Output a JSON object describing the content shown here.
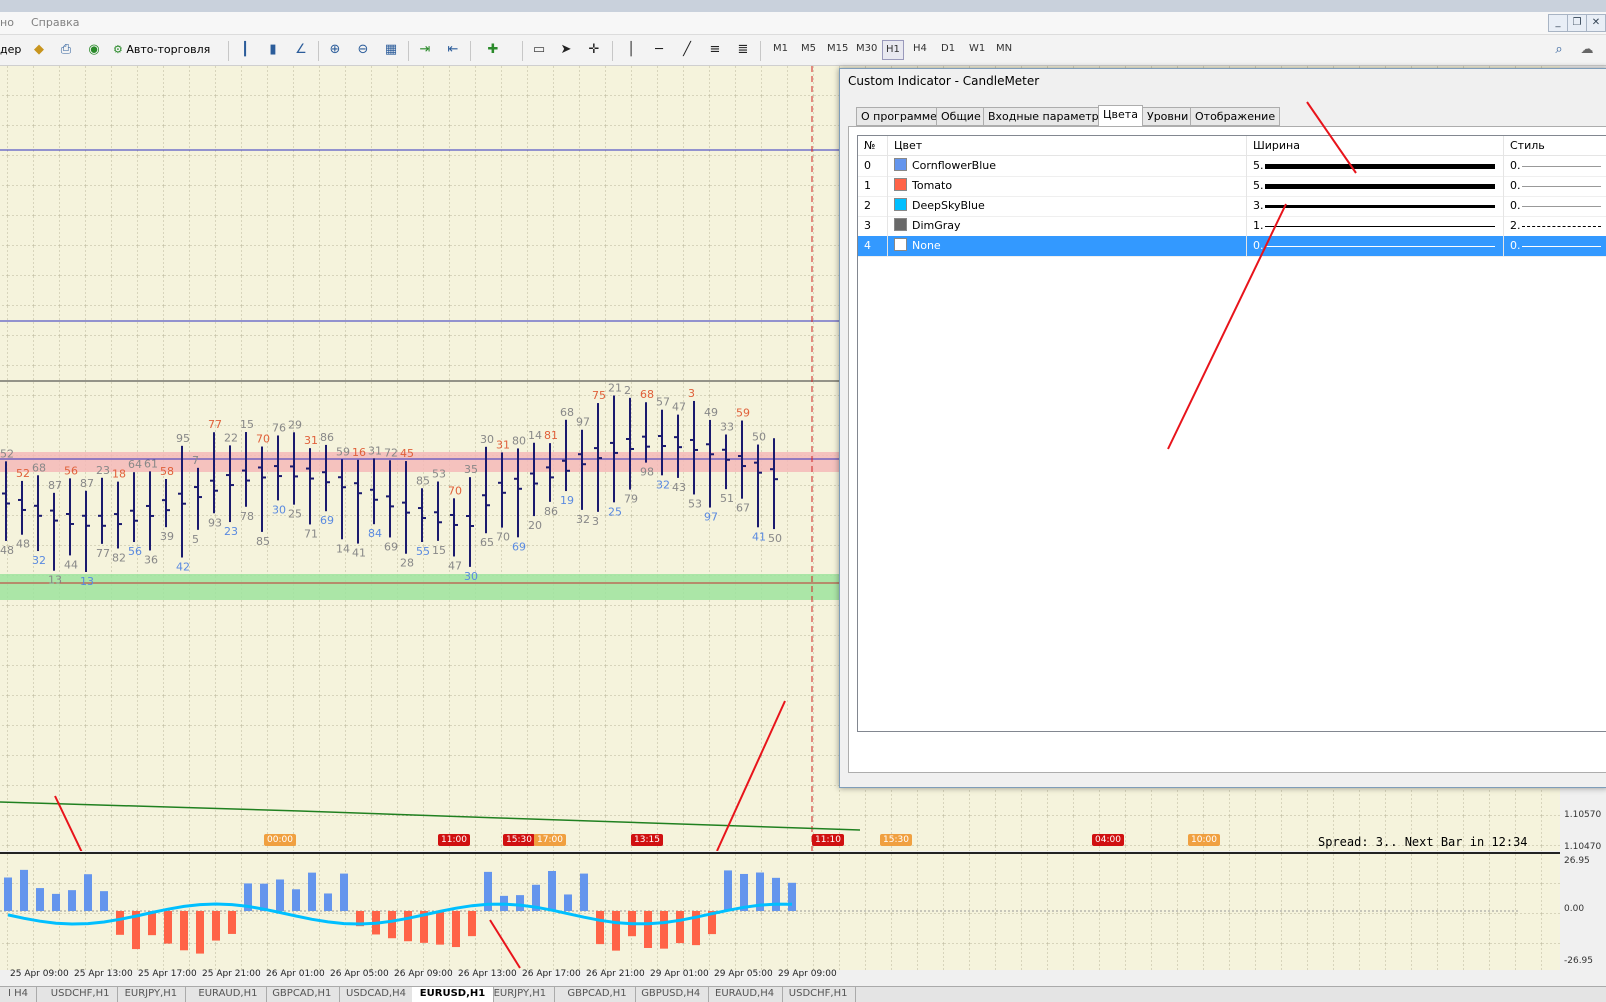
{
  "menubar": {
    "item_prev": "но",
    "item_help": "Справка"
  },
  "toolbar": {
    "autotrade_label": "Авто-торговля",
    "trader_label_partial": "дер",
    "timeframes": [
      "M1",
      "M5",
      "M15",
      "M30",
      "H1",
      "H4",
      "D1",
      "W1",
      "MN"
    ],
    "active_timeframe": "H1"
  },
  "dialog": {
    "title": "Custom Indicator - CandleMeter",
    "tabs": [
      "О программе",
      "Общие",
      "Входные параметры",
      "Цвета",
      "Уровни",
      "Отображение"
    ],
    "active_tab": "Цвета",
    "columns": {
      "num": "№",
      "color": "Цвет",
      "width": "Ширина",
      "style": "Стиль"
    },
    "rows": [
      {
        "num": "0",
        "color_name": "CornflowerBlue",
        "swatch": "#6495ed",
        "width": "5.",
        "style": "0."
      },
      {
        "num": "1",
        "color_name": "Tomato",
        "swatch": "#ff6347",
        "width": "5.",
        "style": "0."
      },
      {
        "num": "2",
        "color_name": "DeepSkyBlue",
        "swatch": "#00bfff",
        "width": "3.",
        "style": "0."
      },
      {
        "num": "3",
        "color_name": "DimGray",
        "swatch": "#696969",
        "width": "1.",
        "style": "2."
      },
      {
        "num": "4",
        "color_name": "None",
        "swatch": "#ffffff",
        "width": "0.",
        "style": "0."
      }
    ],
    "selected_row": 4
  },
  "chart": {
    "spread_text": "Spread: 3.. Next Bar in 12:34",
    "price_labels": [
      "1.10570",
      "1.10470"
    ],
    "sub_levels": [
      "26.95",
      "0.00",
      "-26.95"
    ],
    "time_markers": [
      "00:00",
      "11:00",
      "15:30",
      "17:00",
      "13:15",
      "11:10",
      "15:30",
      "04:00",
      "10:00"
    ],
    "time_axis": [
      "25 Apr 09:00",
      "25 Apr 13:00",
      "25 Apr 17:00",
      "25 Apr 21:00",
      "26 Apr 01:00",
      "26 Apr 05:00",
      "26 Apr 09:00",
      "26 Apr 13:00",
      "26 Apr 17:00",
      "26 Apr 21:00",
      "29 Apr 01:00",
      "29 Apr 05:00",
      "29 Apr 09:00"
    ],
    "candle_numbers_top": [
      "52",
      "52",
      "68",
      "87",
      "56",
      "87",
      "23",
      "18",
      "64",
      "61",
      "58",
      "95",
      "7",
      "77",
      "22",
      "15",
      "70",
      "76",
      "29",
      "31",
      "86",
      "59",
      "16",
      "31",
      "72",
      "45",
      "85",
      "53",
      "70",
      "35",
      "30",
      "31",
      "80",
      "14",
      "81",
      "68",
      "97",
      "75",
      "21",
      "2",
      "68",
      "57",
      "47",
      "3",
      "49",
      "33",
      "59",
      "50"
    ],
    "candle_numbers_bottom": [
      "48",
      "48",
      "32",
      "13",
      "44",
      "13",
      "77",
      "82",
      "56",
      "36",
      "39",
      "42",
      "5",
      "93",
      "23",
      "78",
      "85",
      "30",
      "25",
      "71",
      "69",
      "14",
      "41",
      "84",
      "69",
      "28",
      "55",
      "15",
      "47",
      "30",
      "65",
      "70",
      "69",
      "20",
      "86",
      "19",
      "32",
      "3",
      "25",
      "79",
      "98",
      "32",
      "43",
      "53",
      "97",
      "51",
      "67",
      "41",
      "50"
    ]
  },
  "symbol_tabs": [
    "I H4",
    "USDCHF,H1",
    "EURJPY,H1",
    "EURAUD,H1",
    "GBPCAD,H1",
    "USDCAD,H4",
    "EURUSD,H1",
    "EURJPY,H1",
    "GBPCAD,H1",
    "GBPUSD,H4",
    "EURAUD,H4",
    "USDCHF,H1"
  ],
  "active_symbol_tab": "EURUSD,H1",
  "colors": {
    "annotation_arrow": "#e8141b",
    "pink_zone": "#f4b8b8",
    "green_zone": "#9ee39e",
    "bar_blue": "#6495ed",
    "bar_red": "#ff6347",
    "line_cyan": "#00bfff",
    "candle": "#1a1a6e"
  }
}
